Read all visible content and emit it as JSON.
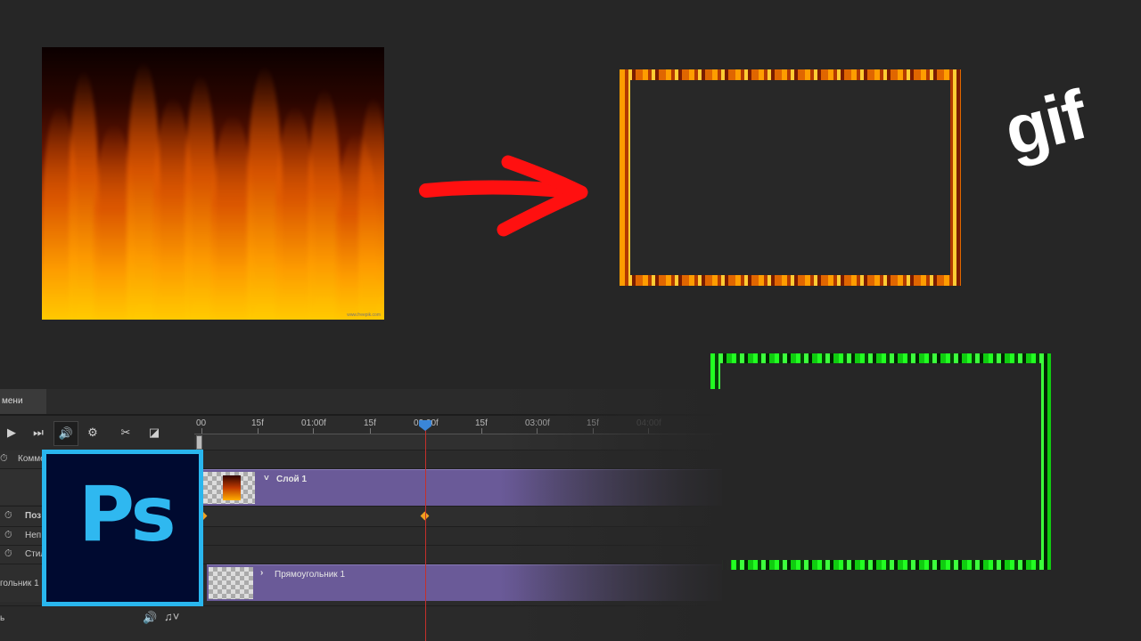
{
  "overlay": {
    "gif_text": "gif",
    "logo_text": "Ps",
    "fire_watermark": "www.freepik.com"
  },
  "panel": {
    "tab_label": "мени",
    "ruler_labels": [
      "00",
      "15f",
      "01:00f",
      "15f",
      "02:00f",
      "15f",
      "03:00f",
      "15f",
      "04:00f"
    ]
  },
  "controls": {
    "play_icon": "▶",
    "step_icon": "⏭",
    "audio_icon": "🔊",
    "settings_icon": "⚙",
    "split_icon": "✂",
    "transition_icon": "◪"
  },
  "layers": {
    "comments_label": "Комме",
    "layer1_label": "Слой 1",
    "prop_position": "Поз",
    "prop_opacity": "Неп",
    "prop_style": "Стил",
    "layer2_name_left": "гольник 1",
    "layer2_clip_label": "Прямоугольник 1",
    "bottom_left_label": "ь"
  },
  "colors": {
    "ps_blue": "#29b6ee",
    "ps_bg": "#000a30",
    "clip_purple": "#6a5a98",
    "playhead": "#3a86d8",
    "arrow_red": "#ff1010"
  }
}
